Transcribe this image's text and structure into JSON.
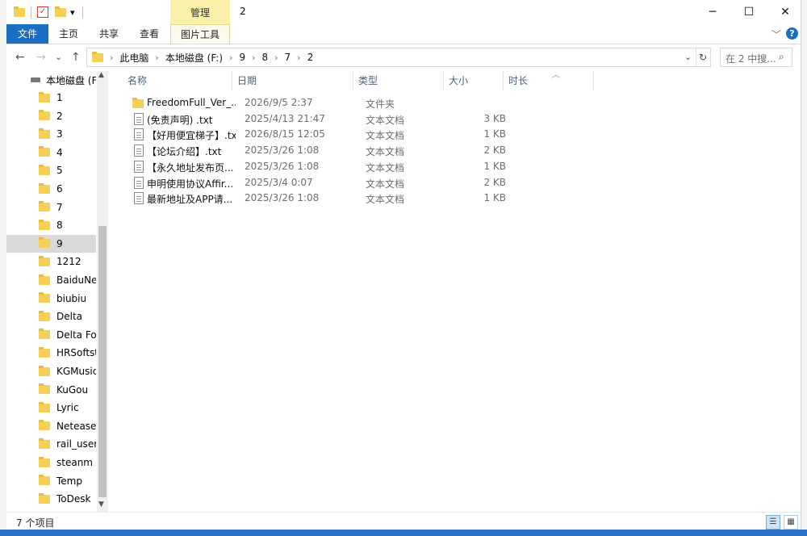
{
  "window": {
    "title": "2",
    "manage_tab": "管理",
    "minimize": "─",
    "maximize": "☐",
    "close": "✕",
    "qa_dropdown": "▾"
  },
  "ribbon": {
    "tabs": [
      "文件",
      "主页",
      "共享",
      "查看",
      "图片工具"
    ],
    "collapse_glyph": "﹀",
    "help": "?"
  },
  "address": {
    "breadcrumbs": [
      "此电脑",
      "本地磁盘 (F:)",
      "9",
      "8",
      "7",
      "2"
    ],
    "search_placeholder": "在 2 中搜...",
    "back": "←",
    "forward": "→",
    "recent": "⌄",
    "up": "↑",
    "refresh": "↻",
    "dropdown": "⌄"
  },
  "nav": {
    "drive": "本地磁盘 (F:)",
    "selected": "9",
    "folders": [
      "1",
      "2",
      "3",
      "4",
      "5",
      "6",
      "7",
      "8",
      "9",
      "1212",
      "BaiduNetdisk",
      "biubiu",
      "Delta",
      "Delta Force",
      "HRSoftstore",
      "KGMusic",
      "KuGou",
      "Lyric",
      "Netease",
      "rail_user_data",
      "steanm",
      "Temp",
      "ToDesk"
    ]
  },
  "columns": {
    "name": "名称",
    "date": "日期",
    "type": "类型",
    "size": "大小",
    "duration": "时长"
  },
  "files": [
    {
      "name": "FreedomFull_Ver_...",
      "date": "2026/9/5 2:37",
      "type": "文件夹",
      "size": "",
      "kind": "folder"
    },
    {
      "name": "(免责声明) .txt",
      "date": "2025/4/13 21:47",
      "type": "文本文档",
      "size": "3 KB",
      "kind": "doc"
    },
    {
      "name": "【好用便宜梯子】.txt",
      "date": "2026/8/15 12:05",
      "type": "文本文档",
      "size": "1 KB",
      "kind": "doc"
    },
    {
      "name": "【论坛介绍】.txt",
      "date": "2025/3/26 1:08",
      "type": "文本文档",
      "size": "2 KB",
      "kind": "doc"
    },
    {
      "name": "【永久地址发布页...",
      "date": "2025/3/26 1:08",
      "type": "文本文档",
      "size": "1 KB",
      "kind": "doc"
    },
    {
      "name": "申明使用协议Affir...",
      "date": "2025/3/4 0:07",
      "type": "文本文档",
      "size": "2 KB",
      "kind": "doc"
    },
    {
      "name": "最新地址及APP请...",
      "date": "2025/3/26 1:08",
      "type": "文本文档",
      "size": "1 KB",
      "kind": "doc"
    }
  ],
  "status": {
    "item_count": "7 个项目"
  },
  "colors": {
    "accent": "#1a6fc3",
    "folder": "#f5cf57",
    "manage_tab": "#fbf0a8",
    "selection": "#d9d9d9"
  }
}
